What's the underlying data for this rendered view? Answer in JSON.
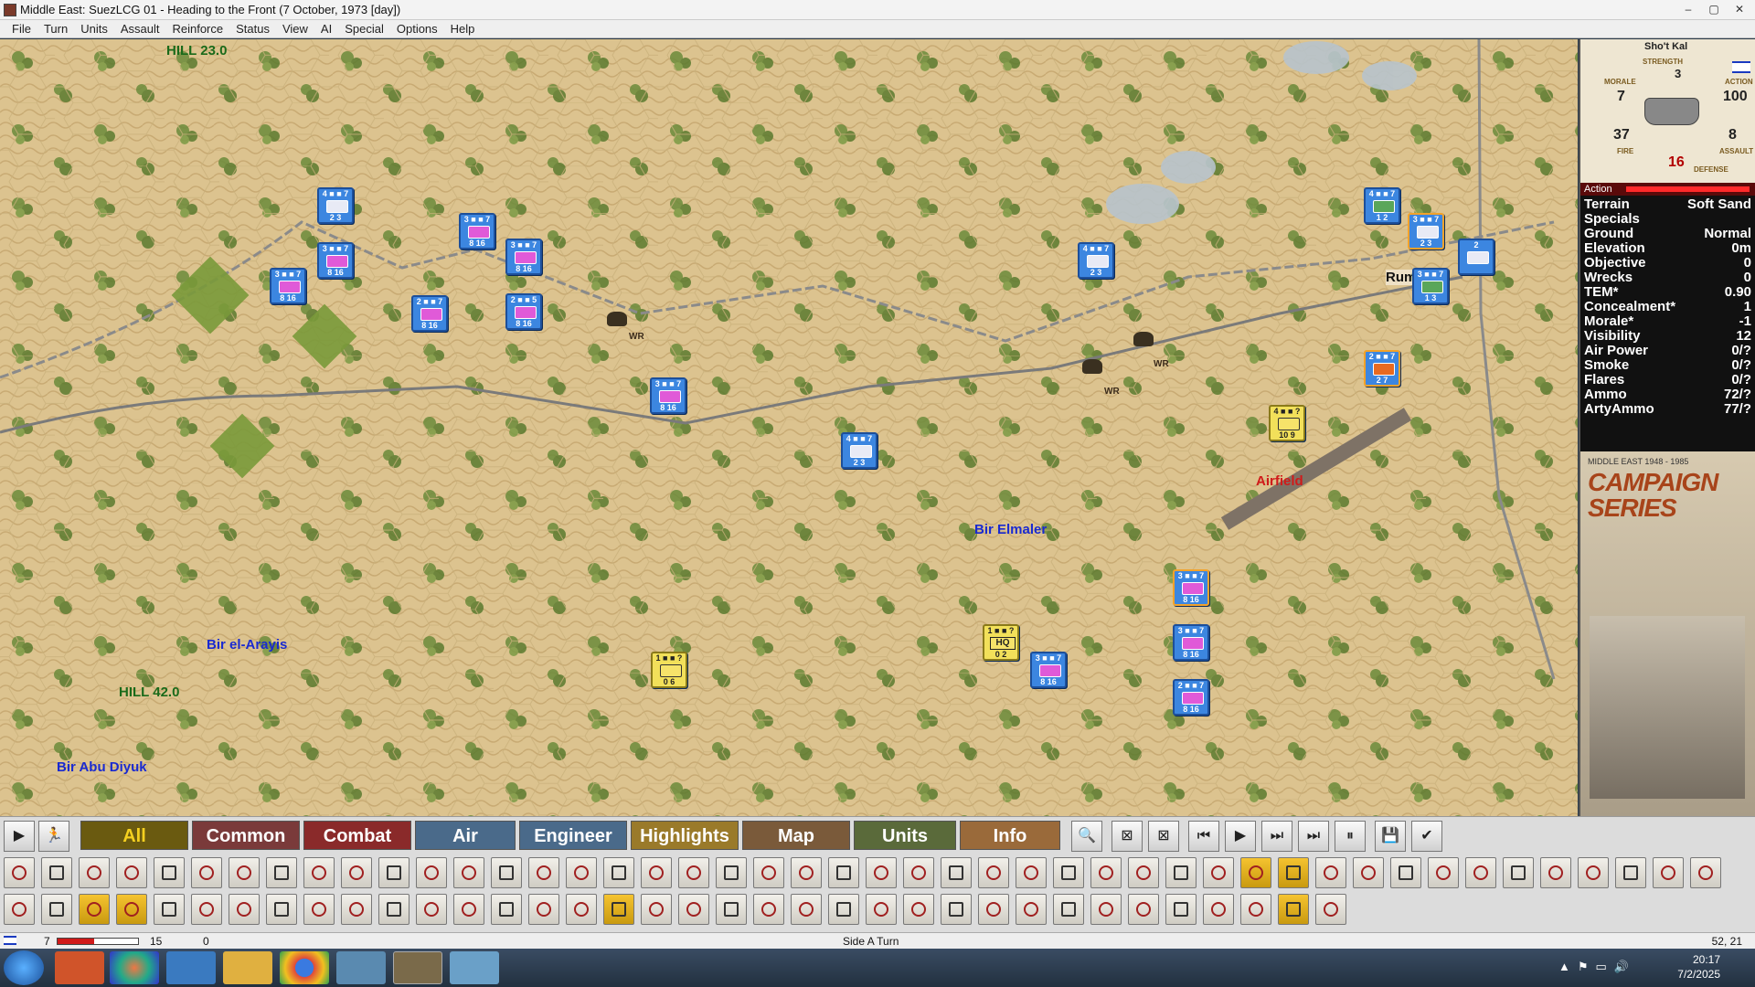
{
  "window": {
    "title": "Middle East: SuezLCG 01 - Heading to the Front (7 October, 1973 [day])",
    "min": "–",
    "max": "▢",
    "close": "✕"
  },
  "menu": [
    "File",
    "Turn",
    "Units",
    "Assault",
    "Reinforce",
    "Status",
    "View",
    "AI",
    "Special",
    "Options",
    "Help"
  ],
  "map": {
    "places": [
      {
        "id": "hill23",
        "name": "HILL 23.0",
        "color": "#1a6a1a"
      },
      {
        "id": "rumani",
        "name": "Rumani",
        "color": "#111111"
      },
      {
        "id": "airfield",
        "name": "Airfield",
        "color": "#d01a1a"
      },
      {
        "id": "birelmaler",
        "name": "Bir Elmaler",
        "color": "#1a2ad0"
      },
      {
        "id": "birelarayis",
        "name": "Bir el-Arayis",
        "color": "#1a2ad0"
      },
      {
        "id": "hill42",
        "name": "HILL 42.0",
        "color": "#1a6a1a"
      },
      {
        "id": "birabudiyuk",
        "name": "Bir Abu Diyuk",
        "color": "#1a2ad0"
      }
    ],
    "wreck_label": "WR",
    "units": [
      {
        "top": "4 ■ ■ 7",
        "bottom": "2  3",
        "sym": "w",
        "side": "isr"
      },
      {
        "top": "3 ■ ■ 7",
        "bottom": "8  16",
        "sym": "p",
        "side": "isr"
      },
      {
        "top": "3 ■ ■ 7",
        "bottom": "8  16",
        "sym": "p",
        "side": "isr"
      },
      {
        "top": "3 ■ ■ 7",
        "bottom": "8  16",
        "sym": "p",
        "side": "isr"
      },
      {
        "top": "3 ■ ■ 7",
        "bottom": "8  16",
        "sym": "p",
        "side": "isr"
      },
      {
        "top": "2 ■ ■ 7",
        "bottom": "8  16",
        "sym": "p",
        "side": "isr"
      },
      {
        "top": "2 ■ ■ 5",
        "bottom": "8  16",
        "sym": "p",
        "side": "isr"
      },
      {
        "top": "3 ■ ■ 7",
        "bottom": "8  16",
        "sym": "p",
        "side": "isr"
      },
      {
        "top": "4 ■ ■ 7",
        "bottom": "2  3",
        "sym": "w",
        "side": "isr"
      },
      {
        "top": "4 ■ ■ 7",
        "bottom": "2  3",
        "sym": "w",
        "side": "isr"
      },
      {
        "top": "4 ■ ■ 7",
        "bottom": "1  2",
        "sym": "g",
        "side": "isr"
      },
      {
        "top": "3 ■ ■ 7",
        "bottom": "2  3",
        "sym": "w",
        "side": "isr",
        "sel": true
      },
      {
        "top": "2",
        "bottom": "",
        "sym": "w",
        "side": "isr"
      },
      {
        "top": "3 ■ ■ 7",
        "bottom": "1  3",
        "sym": "g",
        "side": "isr"
      },
      {
        "top": "2 ■ ■ 7",
        "bottom": "2  7",
        "sym": "o",
        "side": "isr",
        "sel": true
      },
      {
        "top": "4 ■ ■ ?",
        "bottom": "10  9",
        "sym": "p",
        "side": "egy"
      },
      {
        "top": "3 ■ ■ 7",
        "bottom": "8  16",
        "sym": "p",
        "side": "isr",
        "sel": true
      },
      {
        "top": "3 ■ ■ 7",
        "bottom": "8  16",
        "sym": "p",
        "side": "isr"
      },
      {
        "top": "2 ■ ■ 7",
        "bottom": "8  16",
        "sym": "p",
        "side": "isr"
      },
      {
        "top": "1 ■ ■ ?",
        "bottom": "0  2",
        "hq": "HQ",
        "side": "egy"
      },
      {
        "top": "3 ■ ■ 7",
        "bottom": "8  16",
        "sym": "p",
        "side": "isr"
      },
      {
        "top": "1 ■ ■ ?",
        "bottom": "0  6",
        "sym": "p",
        "side": "egy"
      }
    ]
  },
  "panel": {
    "unit_name": "Sho't Kal",
    "labels": {
      "strength": "STRENGTH",
      "morale": "MORALE",
      "action": "ACTION",
      "fire": "FIRE",
      "assault": "ASSAULT",
      "defense": "DEFENSE"
    },
    "strength": "3",
    "morale": "7",
    "action": "100",
    "fire": "37",
    "assault": "8",
    "defense": "16",
    "action_label": "Action",
    "terrain_stats": [
      {
        "k": "Terrain",
        "v": "Soft Sand"
      },
      {
        "k": "Specials",
        "v": ""
      },
      {
        "k": "Ground",
        "v": "Normal"
      },
      {
        "k": "Elevation",
        "v": "0m"
      },
      {
        "k": "Objective",
        "v": "0"
      },
      {
        "k": "Wrecks",
        "v": "0"
      },
      {
        "k": "TEM*",
        "v": "0.90"
      },
      {
        "k": "Concealment*",
        "v": "1"
      },
      {
        "k": "Morale*",
        "v": "-1"
      },
      {
        "k": "Visibility",
        "v": "12"
      },
      {
        "k": "Air Power",
        "v": "0/?"
      },
      {
        "k": "Smoke",
        "v": "0/?"
      },
      {
        "k": "Flares",
        "v": "0/?"
      },
      {
        "k": "Ammo",
        "v": "72/?"
      },
      {
        "k": "ArtyAmmo",
        "v": "77/?"
      }
    ],
    "logo_sub": "MIDDLE EAST 1948 - 1985",
    "logo_main": "CAMPAIGN SERIES"
  },
  "toolbar": {
    "tabs": [
      {
        "label": "All",
        "bg": "#6a5a10",
        "color": "#f5d020"
      },
      {
        "label": "Common",
        "bg": "#7a3a3a",
        "color": "#ffffff"
      },
      {
        "label": "Combat",
        "bg": "#8a2a2a",
        "color": "#ffffff"
      },
      {
        "label": "Air",
        "bg": "#4a6a8a",
        "color": "#ffffff"
      },
      {
        "label": "Engineer",
        "bg": "#4a6a8a",
        "color": "#ffffff"
      },
      {
        "label": "Highlights",
        "bg": "#9a7a2a",
        "color": "#ffffff"
      },
      {
        "label": "Map",
        "bg": "#7a5a3a",
        "color": "#ffffff"
      },
      {
        "label": "Units",
        "bg": "#5a6a3a",
        "color": "#ffffff"
      },
      {
        "label": "Info",
        "bg": "#9a6a3a",
        "color": "#ffffff"
      }
    ],
    "play_controls": [
      "🔍",
      "⊠",
      "⊠",
      "⏮",
      "▶",
      "⏭",
      "⏭",
      "⏸",
      "💾",
      "✔"
    ]
  },
  "status": {
    "v1": "7",
    "v2": "15",
    "v3": "0",
    "turn_text": "Side A Turn",
    "coords": "52, 21"
  },
  "taskbar": {
    "time": "20:17",
    "date": "7/2/2025"
  }
}
